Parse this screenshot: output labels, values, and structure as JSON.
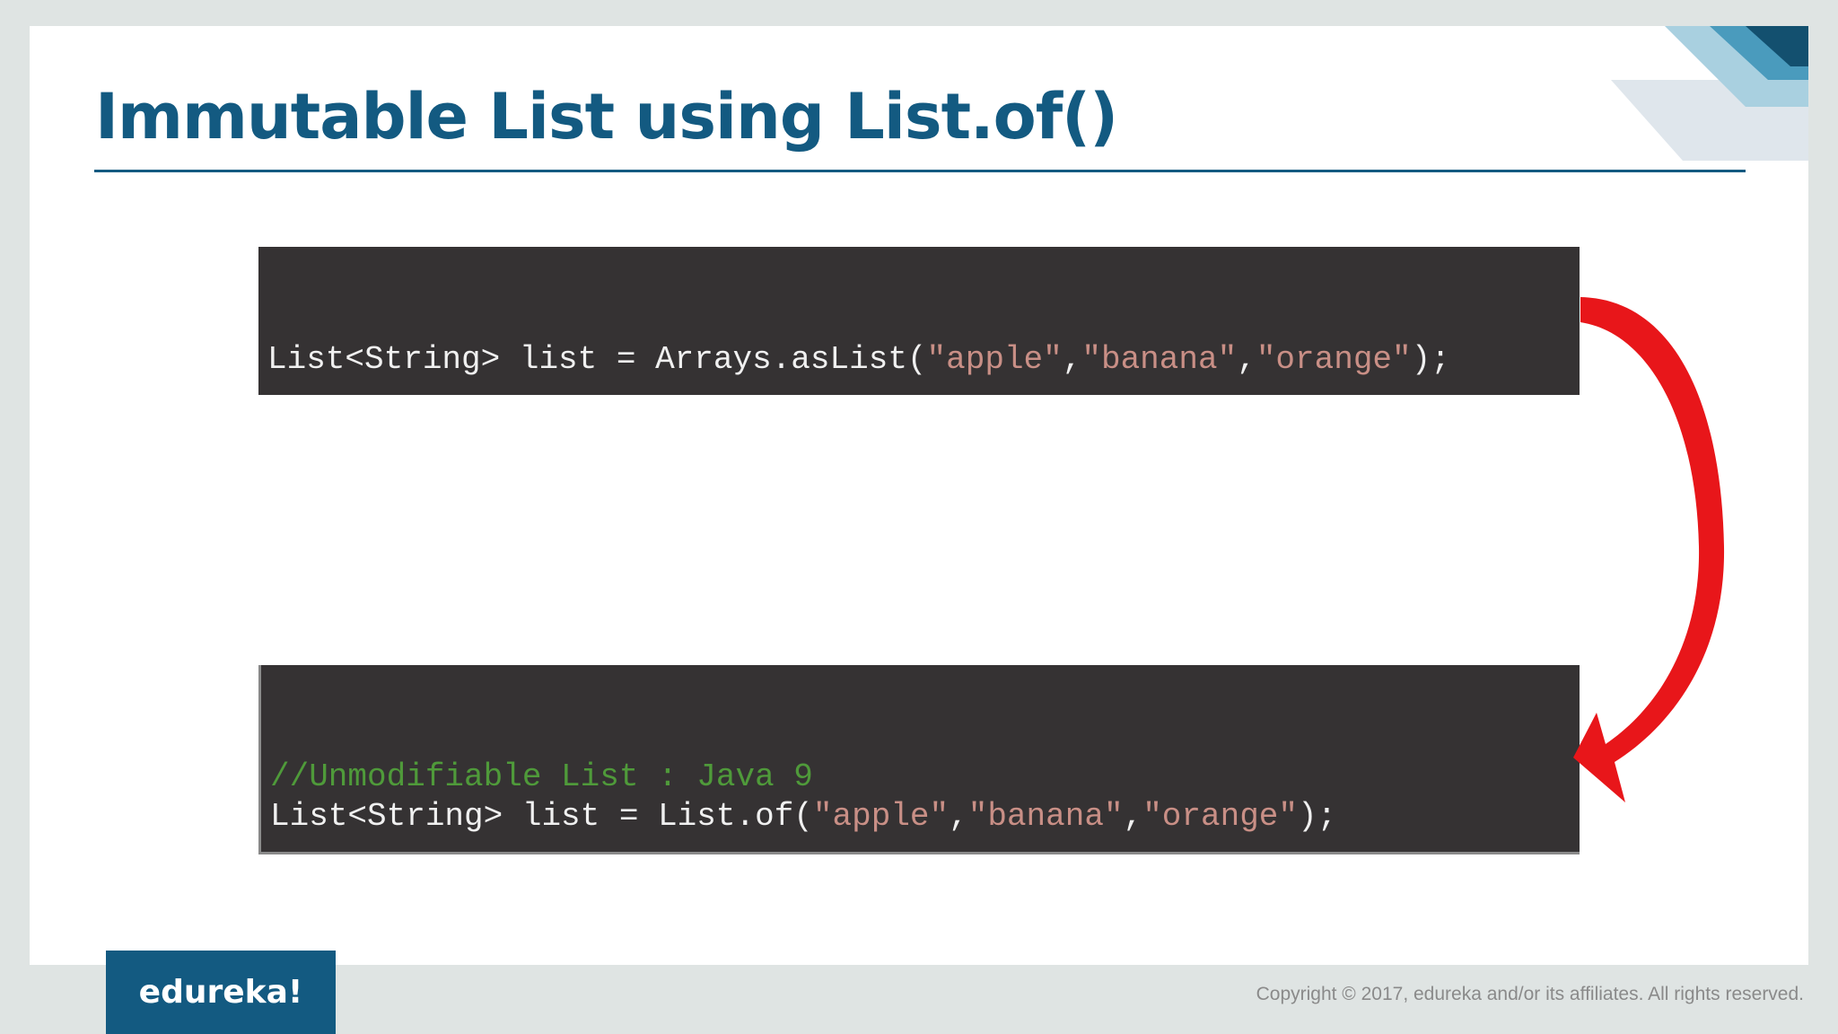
{
  "slide": {
    "title": "Immutable List using List.of()",
    "code_block_1": {
      "line_1": {
        "prefix": "List<String> list = Arrays.asList(",
        "str_1": "\"apple\"",
        "sep_1": ",",
        "str_2": "\"banana\"",
        "sep_2": ",",
        "str_3": "\"orange\"",
        "suffix": ");"
      }
    },
    "code_block_2": {
      "comment": "//Unmodifiable List : Java 9",
      "line_1": {
        "prefix": "List<String> list = List.of(",
        "str_1": "\"apple\"",
        "sep_1": ",",
        "str_2": "\"banana\"",
        "sep_2": ",",
        "str_3": "\"orange\"",
        "suffix": ");"
      }
    },
    "logo": "edureka!",
    "copyright": "Copyright © 2017, edureka and/or its affiliates. All rights reserved."
  },
  "colors": {
    "brand": "#135a81",
    "code_background": "#353233",
    "string": "#c98f86",
    "comment": "#4f9a3a",
    "arrow": "#e8161a"
  },
  "icons": {
    "arrow": "curved-arrow-icon",
    "corner": "corner-decoration-icon"
  }
}
